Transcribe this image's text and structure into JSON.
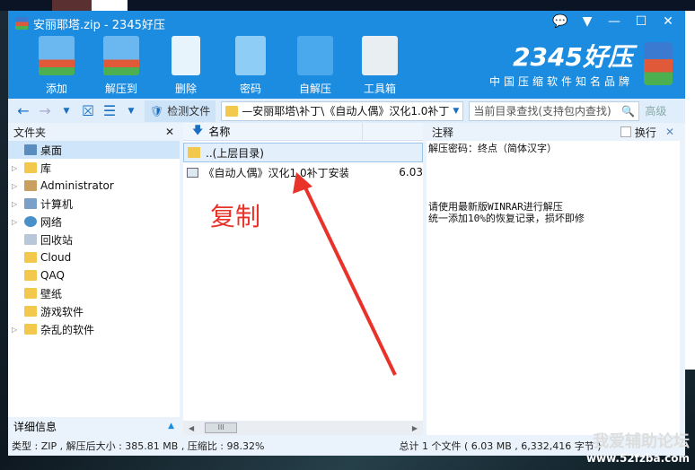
{
  "window": {
    "title": "安丽耶塔.zip - 2345好压"
  },
  "toolbar": {
    "buttons": [
      {
        "label": "添加",
        "color": "#3a9be8"
      },
      {
        "label": "解压到",
        "color": "#3a9be8"
      },
      {
        "label": "删除",
        "color": "#ffffff"
      },
      {
        "label": "密码",
        "color": "#8ecdf5"
      },
      {
        "label": "自解压",
        "color": "#4aa8ec"
      },
      {
        "label": "工具箱",
        "color": "#e8eef2"
      }
    ]
  },
  "brand": {
    "name": "2345好压",
    "slogan": "中国压缩软件知名品牌"
  },
  "addressbar": {
    "check_label": "检测文件",
    "path": "—安丽耶塔\\补丁\\《自动人偶》汉化1.0补丁",
    "search_placeholder": "当前目录查找(支持包内查找)",
    "advanced": "高级"
  },
  "left": {
    "title": "文件夹",
    "items": [
      {
        "label": "桌面",
        "selected": true
      },
      {
        "label": "库"
      },
      {
        "label": "Administrator"
      },
      {
        "label": "计算机"
      },
      {
        "label": "网络"
      },
      {
        "label": "回收站"
      },
      {
        "label": "Cloud"
      },
      {
        "label": "QAQ"
      },
      {
        "label": "壁纸"
      },
      {
        "label": "游戏软件"
      },
      {
        "label": "杂乱的软件"
      }
    ],
    "detail": "详细信息"
  },
  "filelist": {
    "col_name": "名称",
    "parent": "..(上层目录)",
    "files": [
      {
        "name": "《自动人偶》汉化1.0补丁安装...",
        "size": "6.03"
      }
    ]
  },
  "notes": {
    "title": "注释",
    "wrap_label": "换行",
    "lines": "解压密码：终点（简体汉字）\n\n\n\n\n请使用最新版WINRAR进行解压\n统一添加10%的恢复记录，损坏即修"
  },
  "status": {
    "left": "类型 : ZIP , 解压后大小 : 385.81 MB , 压缩比 : 98.32%",
    "right": "总计 1 个文件 ( 6.03 MB , 6,332,416 字节 )"
  },
  "annotation": "复制",
  "watermark": {
    "line1": "我爱辅助论坛",
    "line2": "www.52fzba.com"
  }
}
